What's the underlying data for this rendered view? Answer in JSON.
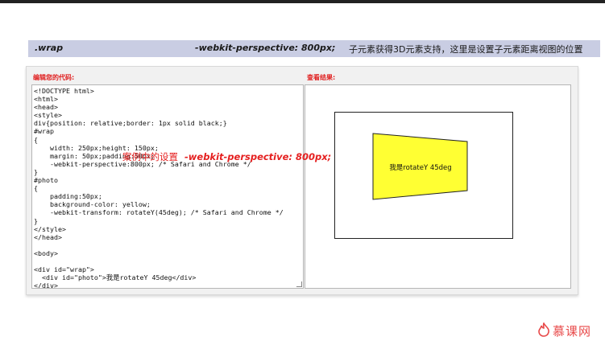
{
  "header": {
    "selector": ".wrap",
    "property": "-webkit-perspective: 800px;",
    "description": "子元素获得3D元素支持，这里是设置子元素距离视图的位置"
  },
  "editor": {
    "title": "编辑您的代码:",
    "code": "<!DOCTYPE html>\n<html>\n<head>\n<style>\ndiv{position: relative;border: 1px solid black;}\n#wrap\n{\n    width: 250px;height: 150px;\n    margin: 50px;padding:50px;\n    -webkit-perspective:800px; /* Safari and Chrome */\n}\n#photo\n{\n    padding:50px;\n    background-color: yellow;\n    -webkit-transform: rotateY(45deg); /* Safari and Chrome */\n}\n</style>\n</head>\n\n<body>\n\n<div id=\"wrap\">\n  <div id=\"photo\">我是rotateY 45deg</div>\n</div>"
  },
  "result": {
    "title": "查看结果:",
    "photo_text": "我是rotateY 45deg",
    "photo_color": "#ffff33"
  },
  "overlay": {
    "label": "案例中的设置",
    "property": "-webkit-perspective: 800px;"
  },
  "logo": {
    "text": "慕课网",
    "color": "#e84a4a"
  }
}
